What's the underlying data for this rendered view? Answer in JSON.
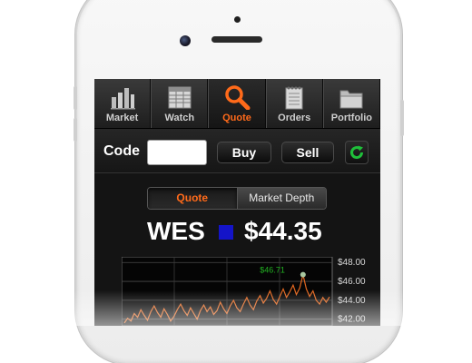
{
  "tabs": [
    {
      "label": "Market",
      "icon": "bar-chart-icon",
      "active": false
    },
    {
      "label": "Watch",
      "icon": "grid-table-icon",
      "active": false
    },
    {
      "label": "Quote",
      "icon": "magnifier-icon",
      "active": true
    },
    {
      "label": "Orders",
      "icon": "notepad-icon",
      "active": false
    },
    {
      "label": "Portfolio",
      "icon": "folder-icon",
      "active": false
    }
  ],
  "code_bar": {
    "label": "Code",
    "input_value": "",
    "buy_label": "Buy",
    "sell_label": "Sell",
    "refresh_icon": "refresh-icon"
  },
  "segments": [
    "Quote",
    "Market Depth"
  ],
  "quote": {
    "symbol": "WES",
    "price": "$44.35",
    "swatch_color": "#1414c8"
  },
  "colors": {
    "accent": "#ff6a1a",
    "line": "#e0661f",
    "high_label": "#22b022",
    "refresh": "#1fbf3a"
  },
  "chart_data": {
    "type": "line",
    "annotations": [
      {
        "text": "$46.71",
        "value": 46.71
      }
    ],
    "y_ticks": [
      "$48.00",
      "$46.00",
      "$44.00",
      "$42.00"
    ],
    "ylim": [
      41.3,
      48.6
    ],
    "grid": true,
    "series": [
      {
        "values": [
          41.6,
          42.1,
          41.8,
          42.6,
          42.2,
          43.0,
          42.4,
          41.9,
          42.8,
          43.4,
          42.7,
          42.2,
          43.1,
          42.5,
          41.8,
          42.3,
          43.0,
          43.6,
          42.9,
          42.4,
          43.2,
          42.6,
          42.0,
          42.9,
          43.5,
          42.8,
          43.3,
          42.5,
          42.9,
          43.8,
          43.1,
          42.6,
          43.4,
          44.0,
          43.2,
          42.8,
          43.6,
          44.3,
          43.5,
          43.0,
          43.9,
          44.5,
          43.7,
          44.2,
          45.0,
          44.1,
          43.6,
          44.4,
          45.2,
          44.3,
          44.9,
          45.6,
          44.6,
          45.3,
          46.71,
          45.2,
          44.4,
          45.0,
          44.0,
          43.6,
          44.3,
          43.8,
          44.35
        ]
      }
    ]
  }
}
